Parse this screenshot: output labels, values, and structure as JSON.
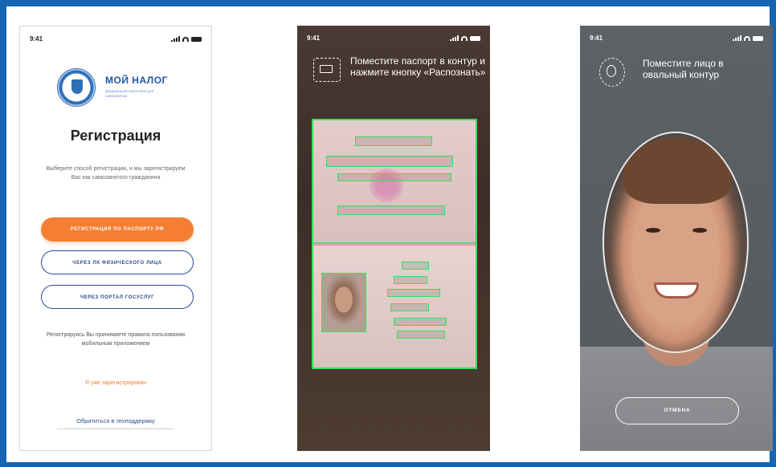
{
  "phone1": {
    "time": "9:41",
    "brand_title": "МОЙ НАЛОГ",
    "brand_sub": "федеральная налоговая для самозанятых",
    "title": "Регистрация",
    "description": "Выберите способ регистрации, и мы зарегистрируем Вас как самозанятого гражданина",
    "btn_passport": "РЕГИСТРАЦИЯ ПО ПАСПОРТУ РФ",
    "btn_lk": "ЧЕРЕЗ ЛК ФИЗИЧЕСКОГО ЛИЦА",
    "btn_gosuslugi": "ЧЕРЕЗ ПОРТАЛ ГОСУСЛУГ",
    "terms": "Регистрируясь Вы принимаете правила пользования мобильным приложением",
    "already": "Я уже зарегистрирован",
    "support": "Обратиться в техподдержку"
  },
  "phone2": {
    "time": "9:41",
    "hint": "Поместите паспорт в контур и нажмите кнопку «Распознать»"
  },
  "phone3": {
    "time": "9:41",
    "hint": "Поместите лицо в овальный контур",
    "cancel": "ОТМЕНА"
  },
  "colors": {
    "frame": "#1565b3",
    "accent": "#f47e32",
    "brand": "#2157a3",
    "scan_green": "#33e05a"
  }
}
